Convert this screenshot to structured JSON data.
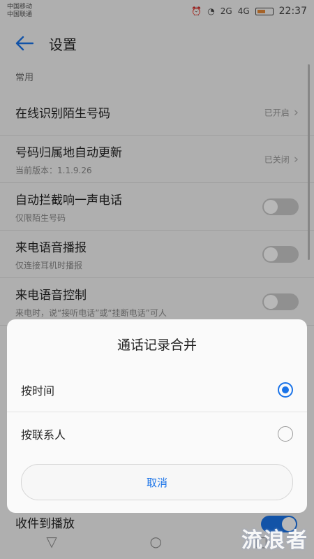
{
  "status": {
    "carrier1": "中国移动",
    "carrier2": "中国联通",
    "time": "22:37",
    "net1": "2G",
    "net2": "4G",
    "battery_level": 0.55,
    "battery_color": "#e58a3a"
  },
  "appbar": {
    "title": "设置"
  },
  "section": {
    "label": "常用"
  },
  "items": [
    {
      "title": "在线识别陌生号码",
      "sub": "",
      "status": "已开启",
      "control": "chevron"
    },
    {
      "title": "号码归属地自动更新",
      "sub": "当前版本：1.1.9.26",
      "status": "已关闭",
      "control": "chevron"
    },
    {
      "title": "自动拦截响一声电话",
      "sub": "仅限陌生号码",
      "control": "toggle",
      "on": false
    },
    {
      "title": "来电语音播报",
      "sub": "仅连接耳机时播报",
      "control": "toggle",
      "on": false
    },
    {
      "title": "来电语音控制",
      "sub": "来电时，说“接听电话”或“挂断电话”可人",
      "control": "toggle",
      "on": false
    }
  ],
  "peek_item": {
    "title": "收件到播放",
    "on": true
  },
  "dialog": {
    "title": "通话记录合并",
    "options": [
      {
        "label": "按时间",
        "selected": true
      },
      {
        "label": "按联系人",
        "selected": false
      }
    ],
    "cancel": "取消"
  },
  "watermark": "流浪者",
  "colors": {
    "accent": "#1a73e8"
  }
}
